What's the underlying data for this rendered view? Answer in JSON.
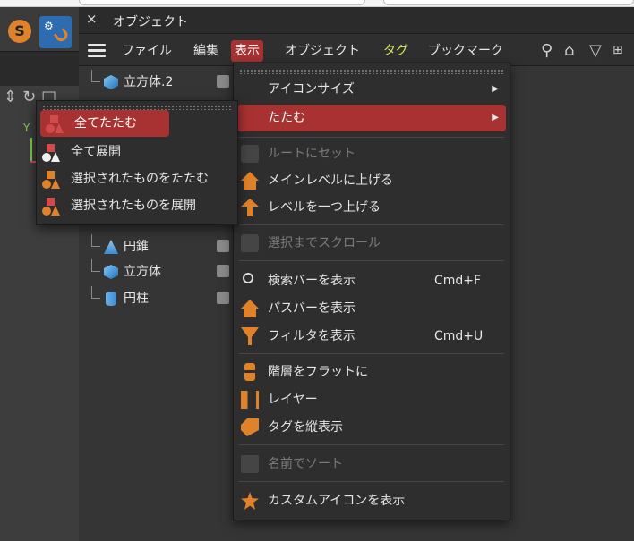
{
  "window": {
    "title": "オブジェクト",
    "close_glyph": "×"
  },
  "left_panel": {
    "s_badge": "S",
    "axis_y_label": "Y"
  },
  "menubar": {
    "items": [
      {
        "label": "ファイル"
      },
      {
        "label": "編集"
      },
      {
        "label": "表示",
        "active": true
      },
      {
        "label": "オブジェクト"
      },
      {
        "label": "タグ"
      },
      {
        "label": "ブックマーク"
      }
    ],
    "right_icons": [
      "search-icon",
      "home-icon",
      "filter-icon"
    ]
  },
  "tree": {
    "rows": [
      {
        "label": "立方体.2",
        "icon": "cube-icon"
      },
      {
        "label": "円錐",
        "icon": "cone-icon"
      },
      {
        "label": "立方体",
        "icon": "cube-icon"
      },
      {
        "label": "円柱",
        "icon": "cylinder-icon"
      }
    ]
  },
  "view_menu": {
    "items": [
      {
        "label": "アイコンサイズ",
        "has_submenu": true
      },
      {
        "label": "たたむ",
        "has_submenu": true,
        "highlighted": true
      },
      {
        "label": "ルートにセット",
        "disabled": true
      },
      {
        "label": "メインレベルに上げる"
      },
      {
        "label": "レベルを一つ上げる"
      },
      {
        "label": "選択までスクロール",
        "disabled": true
      },
      {
        "label": "検索バーを表示",
        "shortcut": "Cmd+F"
      },
      {
        "label": "パスバーを表示"
      },
      {
        "label": "フィルタを表示",
        "shortcut": "Cmd+U"
      },
      {
        "label": "階層をフラットに"
      },
      {
        "label": "レイヤー"
      },
      {
        "label": "タグを縦表示"
      },
      {
        "label": "名前でソート",
        "disabled": true
      },
      {
        "label": "カスタムアイコンを表示"
      }
    ]
  },
  "collapse_submenu": {
    "items": [
      {
        "label": "全てたたむ",
        "highlighted": true
      },
      {
        "label": "全て展開"
      },
      {
        "label": "選択されたものをたたむ"
      },
      {
        "label": "選択されたものを展開"
      }
    ]
  },
  "colors": {
    "accent": "#a83232",
    "orange": "#e0822a",
    "tag_menu": "#d6e65a",
    "bg": "#333333"
  }
}
